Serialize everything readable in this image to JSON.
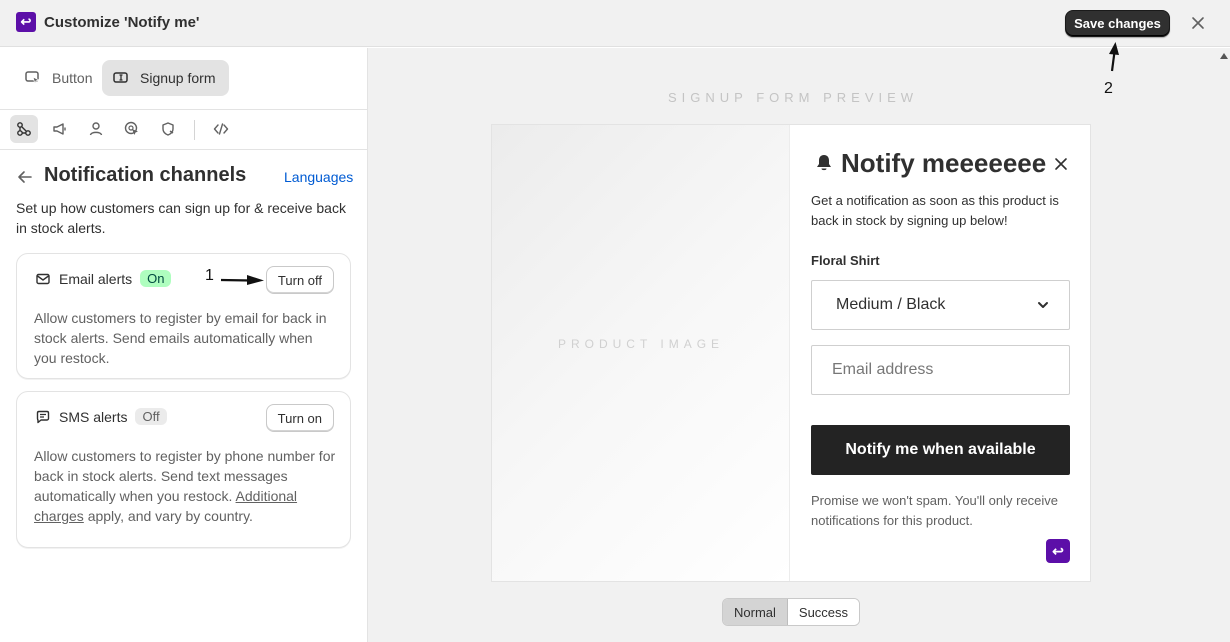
{
  "header": {
    "title": "Customize 'Notify me'",
    "save_label": "Save changes"
  },
  "annotations": {
    "one": "1",
    "two": "2"
  },
  "sidebar": {
    "tabs": [
      {
        "label": "Button",
        "icon": "cursor-button-icon",
        "active": false
      },
      {
        "label": "Signup form",
        "icon": "form-cursor-icon",
        "active": true
      }
    ],
    "tools": [
      "channels-icon",
      "megaphone-icon",
      "person-icon",
      "target-cursor-icon",
      "shield-icon",
      "code-icon"
    ],
    "section_title": "Notification channels",
    "languages_label": "Languages",
    "section_desc": "Set up how customers can sign up for & receive back in stock alerts.",
    "email_card": {
      "title": "Email alerts",
      "badge": "On",
      "button": "Turn off",
      "desc": "Allow customers to register by email for back in stock alerts. Send emails automatically when you restock."
    },
    "sms_card": {
      "title": "SMS alerts",
      "badge": "Off",
      "button": "Turn on",
      "desc_before": "Allow customers to register by phone number for back in stock alerts. Send text messages automatically when you restock. ",
      "link": "Additional charges",
      "desc_after": " apply, and vary by country."
    }
  },
  "preview": {
    "label": "SIGNUP FORM PREVIEW",
    "product_image_label": "PRODUCT IMAGE",
    "form_title": "Notify meeeeeee",
    "form_desc": "Get a notification as soon as this product is back in stock by signing up below!",
    "product_name": "Floral Shirt",
    "variant_selected": "Medium / Black",
    "email_placeholder": "Email address",
    "notify_button": "Notify me when available",
    "spam_note": "Promise we won't spam. You'll only receive notifications for this product.",
    "states": [
      "Normal",
      "Success"
    ]
  },
  "colors": {
    "brand": "#5c0fa8",
    "link": "#005bd3",
    "badge_on": "#affebf"
  }
}
